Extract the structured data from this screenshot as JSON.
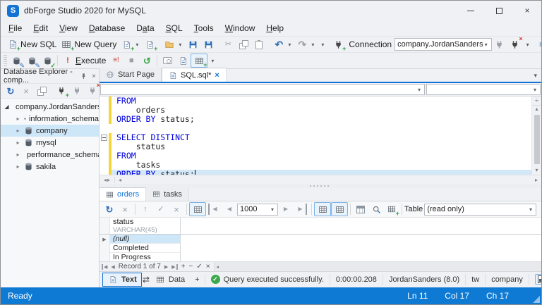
{
  "icons": {
    "close": "×",
    "dropdown": "▾",
    "undo": "↶",
    "redo": "↷",
    "cut": "✂",
    "refresh": "↻",
    "history": "↺",
    "stop": "■",
    "bang": "!",
    "script": "≡!",
    "swap": "⇄",
    "check": "✓",
    "cross": "×",
    "plus": "+",
    "minus": "−",
    "prev": "◀",
    "next": "▶",
    "up": "▴",
    "down": "▾",
    "left": "◂",
    "right": "▸",
    "tree_collapsed": "▸",
    "tree_expanded": "◢",
    "row_marker": "▶",
    "splitter": "÷",
    "arrow_up": "↑"
  },
  "window": {
    "logo": "S",
    "title": "dbForge Studio 2020 for MySQL"
  },
  "menu": {
    "items": [
      {
        "label": "File",
        "accel": 0
      },
      {
        "label": "Edit",
        "accel": 0
      },
      {
        "label": "View",
        "accel": 0
      },
      {
        "label": "Database",
        "accel": 0
      },
      {
        "label": "Data",
        "accel": 1
      },
      {
        "label": "SQL",
        "accel": 0
      },
      {
        "label": "Tools",
        "accel": 0
      },
      {
        "label": "Window",
        "accel": 0
      },
      {
        "label": "Help",
        "accel": 0
      }
    ]
  },
  "toolbar_main": {
    "new_sql": "New SQL",
    "new_query": "New Query",
    "connection_label": "Connection",
    "connection_value": "company.JordanSanders"
  },
  "toolbar_exec": {
    "execute": "Execute"
  },
  "explorer": {
    "title": "Database Explorer - comp...",
    "root": {
      "label": "company.JordanSanders"
    },
    "nodes": [
      {
        "label": "information_schema",
        "selected": false
      },
      {
        "label": "company",
        "selected": true
      },
      {
        "label": "mysql",
        "selected": false
      },
      {
        "label": "performance_schema",
        "selected": false
      },
      {
        "label": "sakila",
        "selected": false
      }
    ]
  },
  "doc_tabs": [
    {
      "label": "Start Page",
      "active": false,
      "closable": false
    },
    {
      "label": "SQL.sql*",
      "active": true,
      "closable": true
    }
  ],
  "editor": {
    "lines": [
      {
        "changed": true,
        "tokens": [
          {
            "text": "FROM",
            "kw": true
          }
        ]
      },
      {
        "changed": true,
        "tokens": [
          {
            "text": "    orders",
            "kw": false
          }
        ]
      },
      {
        "changed": true,
        "tokens": [
          {
            "text": "ORDER BY",
            "kw": true
          },
          {
            "text": " status;",
            "kw": false
          }
        ]
      },
      {
        "changed": false,
        "tokens": []
      },
      {
        "changed": true,
        "fold": true,
        "tokens": [
          {
            "text": "SELECT DISTINCT",
            "kw": true
          }
        ]
      },
      {
        "changed": true,
        "tokens": [
          {
            "text": "    status",
            "kw": false
          }
        ]
      },
      {
        "changed": true,
        "tokens": [
          {
            "text": "FROM",
            "kw": true
          }
        ]
      },
      {
        "changed": true,
        "tokens": [
          {
            "text": "    tasks",
            "kw": false
          }
        ]
      },
      {
        "changed": true,
        "current": true,
        "tokens": [
          {
            "text": "ORDER BY",
            "kw": true
          },
          {
            "text": " status;",
            "kw": false
          }
        ]
      }
    ]
  },
  "results": {
    "tabs": [
      {
        "label": "orders",
        "active": true
      },
      {
        "label": "tasks",
        "active": false
      }
    ],
    "page_size": "1000",
    "table_label": "Table",
    "table_mode": "(read only)",
    "grid": {
      "column": {
        "name": "status",
        "type": "VARCHAR(45)"
      },
      "rows": [
        {
          "value": "(null)",
          "is_null": true,
          "selected": true
        },
        {
          "value": "Completed",
          "is_null": false,
          "selected": false
        },
        {
          "value": "In Progress",
          "is_null": false,
          "selected": false
        }
      ]
    },
    "record_nav": "Record 1 of 7"
  },
  "doc_bar": {
    "text_tab": "Text",
    "data_tab": "Data",
    "add_tab": "+",
    "message": "Query executed successfully.",
    "duration": "0:00:00.208",
    "server": "JordanSanders (8.0)",
    "charset": "tw",
    "database": "company"
  },
  "status_bar": {
    "state": "Ready",
    "line": "Ln 11",
    "column": "Col 17",
    "char": "Ch 17"
  }
}
